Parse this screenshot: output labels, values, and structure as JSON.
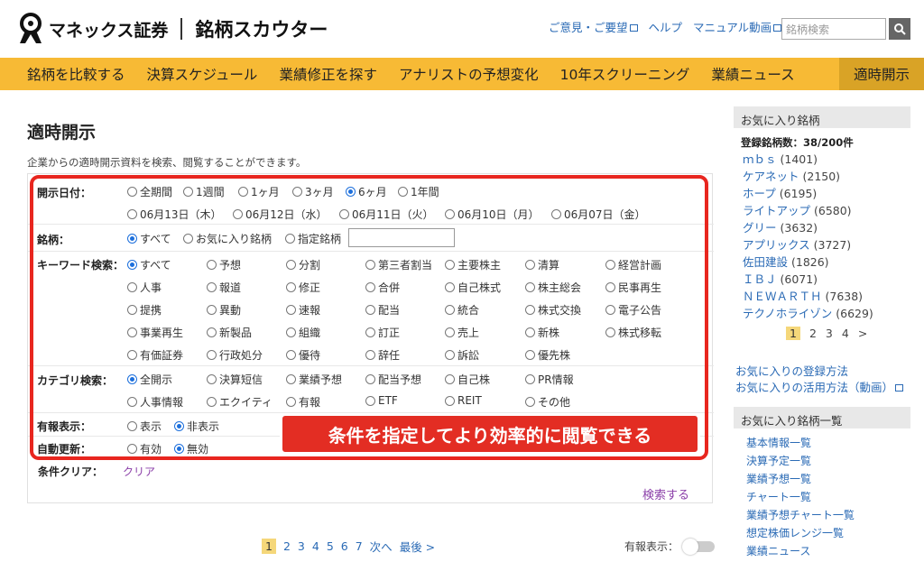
{
  "header": {
    "logo_text": "マネックス証券",
    "logo_sub": "銘柄スカウター",
    "links": [
      "ご意見・ご要望",
      "ヘルプ",
      "マニュアル動画"
    ],
    "search_placeholder": "銘柄検索"
  },
  "nav": [
    "銘柄を比較する",
    "決算スケジュール",
    "業績修正を探す",
    "アナリストの予想変化",
    "10年スクリーニング",
    "業績ニュース",
    "適時開示"
  ],
  "page": {
    "title": "適時開示",
    "description": "企業からの適時開示資料を検索、閲覧することができます。"
  },
  "form": {
    "date_label": "開示日付：",
    "date_options": [
      "全期間",
      "1週間",
      "1ヶ月",
      "3ヶ月",
      "6ヶ月",
      "1年間"
    ],
    "date_selected": "6ヶ月",
    "date_days": [
      "06月13日（木）",
      "06月12日（水）",
      "06月11日（火）",
      "06月10日（月）",
      "06月07日（金）"
    ],
    "stock_label": "銘柄：",
    "stock_options": [
      "すべて",
      "お気に入り銘柄",
      "指定銘柄"
    ],
    "keyword_label": "キーワード検索：",
    "keywords": [
      "すべて",
      "予想",
      "分割",
      "第三者割当",
      "主要株主",
      "清算",
      "経営計画",
      "人事",
      "報道",
      "修正",
      "合併",
      "自己株式",
      "株主総会",
      "民事再生",
      "提携",
      "異動",
      "速報",
      "配当",
      "統合",
      "株式交換",
      "電子公告",
      "事業再生",
      "新製品",
      "組織",
      "訂正",
      "売上",
      "新株",
      "株式移転",
      "有価証券",
      "行政処分",
      "優待",
      "辞任",
      "訴訟",
      "優先株"
    ],
    "category_label": "カテゴリ検索：",
    "categories": [
      "全開示",
      "決算短信",
      "業績予想",
      "配当予想",
      "自己株",
      "PR情報",
      "人事情報",
      "エクイティ",
      "有報",
      "ETF",
      "REIT",
      "その他"
    ],
    "yuho_label": "有報表示：",
    "yuho_options": [
      "表示",
      "非表示"
    ],
    "auto_label": "自動更新：",
    "auto_options": [
      "有効",
      "無効"
    ],
    "clear_label": "条件クリア：",
    "clear_link": "クリア",
    "search_button": "検索する"
  },
  "callout": "条件を指定してより効率的に閲覧できる",
  "pager": {
    "pages": [
      "1",
      "2",
      "3",
      "4",
      "5",
      "6",
      "7"
    ],
    "current": "1",
    "next": "次へ",
    "last": "最後 >"
  },
  "yuho_toggle_label": "有報表示：",
  "sidebar": {
    "fav_title": "お気に入り銘柄",
    "count": "登録銘柄数：38/200件",
    "favorites": [
      {
        "name": "ｍｂｓ",
        "code": "(1401)"
      },
      {
        "name": "ケアネット",
        "code": "(2150)"
      },
      {
        "name": "ホープ",
        "code": "(6195)"
      },
      {
        "name": "ライトアップ",
        "code": "(6580)"
      },
      {
        "name": "グリー",
        "code": "(3632)"
      },
      {
        "name": "アプリックス",
        "code": "(3727)"
      },
      {
        "name": "佐田建設",
        "code": "(1826)"
      },
      {
        "name": "ＩＢＪ",
        "code": "(6071)"
      },
      {
        "name": "ＮＥＷＡＲＴＨ",
        "code": "(7638)"
      },
      {
        "name": "テクノホライゾン",
        "code": "(6629)"
      }
    ],
    "pages": [
      "1",
      "2",
      "3",
      "4",
      ">"
    ],
    "links": [
      "お気に入りの登録方法",
      "お気に入りの活用方法（動画）"
    ],
    "list_title": "お気に入り銘柄一覧",
    "list_links": [
      "基本情報一覧",
      "決算予定一覧",
      "業績予想一覧",
      "チャート一覧",
      "業績予想チャート一覧",
      "想定株価レンジ一覧",
      "業績ニュース"
    ]
  },
  "colors": {
    "nav_bg": "#f7ba35",
    "highlight": "#e8261f",
    "link": "#2a6ab5"
  }
}
